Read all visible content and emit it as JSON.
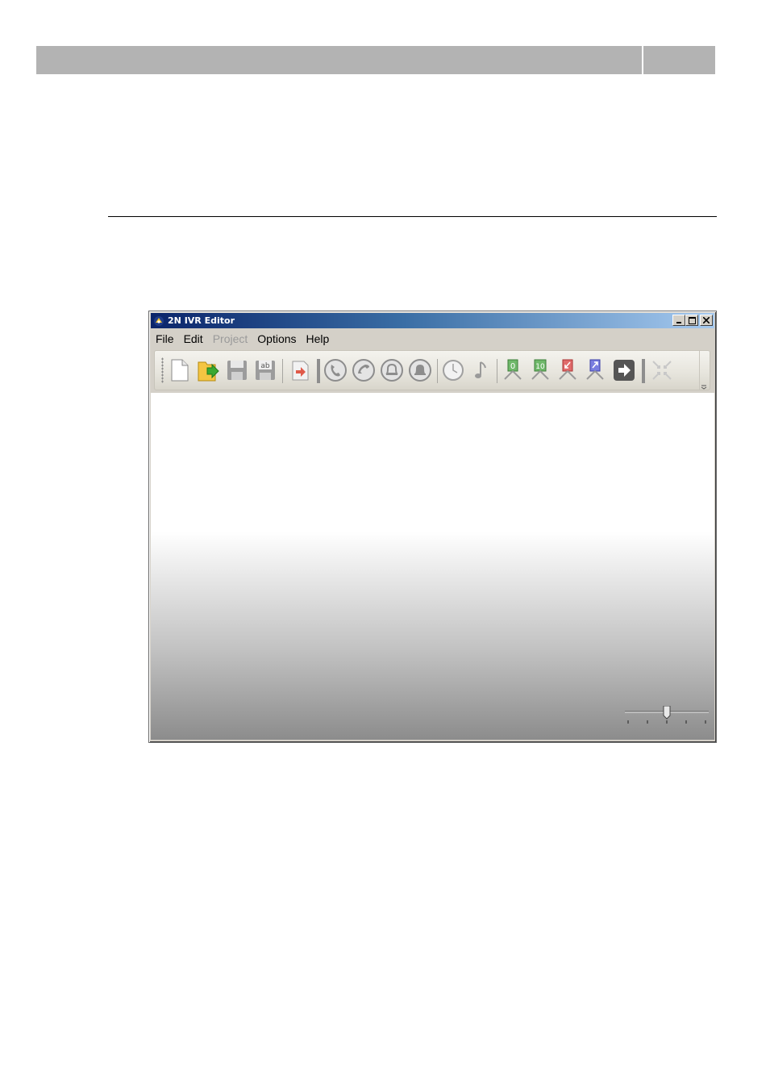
{
  "window": {
    "title": "2N IVR Editor",
    "icon": "app-logo-icon",
    "controls": [
      "minimize-icon",
      "maximize-icon",
      "close-icon"
    ]
  },
  "menu": {
    "items": [
      {
        "label": "File",
        "enabled": true
      },
      {
        "label": "Edit",
        "enabled": true
      },
      {
        "label": "Project",
        "enabled": false
      },
      {
        "label": "Options",
        "enabled": true
      },
      {
        "label": "Help",
        "enabled": true
      }
    ]
  },
  "toolbar": {
    "icons": [
      "new-document-icon",
      "open-folder-icon",
      "save-icon",
      "save-as-icon",
      "export-icon",
      "incoming-call-icon",
      "outgoing-call-icon",
      "bell-icon",
      "bell-filled-icon",
      "clock-icon",
      "music-note-icon",
      "branch-0-icon",
      "branch-10-icon",
      "branch-down-icon",
      "branch-up-icon",
      "jump-arrow-icon",
      "collapse-icon"
    ],
    "branch_badges": [
      "0",
      "10"
    ]
  },
  "zoom": {
    "level_fraction": 0.5
  },
  "colors": {
    "title_start": "#0a246a",
    "title_end": "#a6caf0",
    "doc_header": "#b3b3b3"
  }
}
